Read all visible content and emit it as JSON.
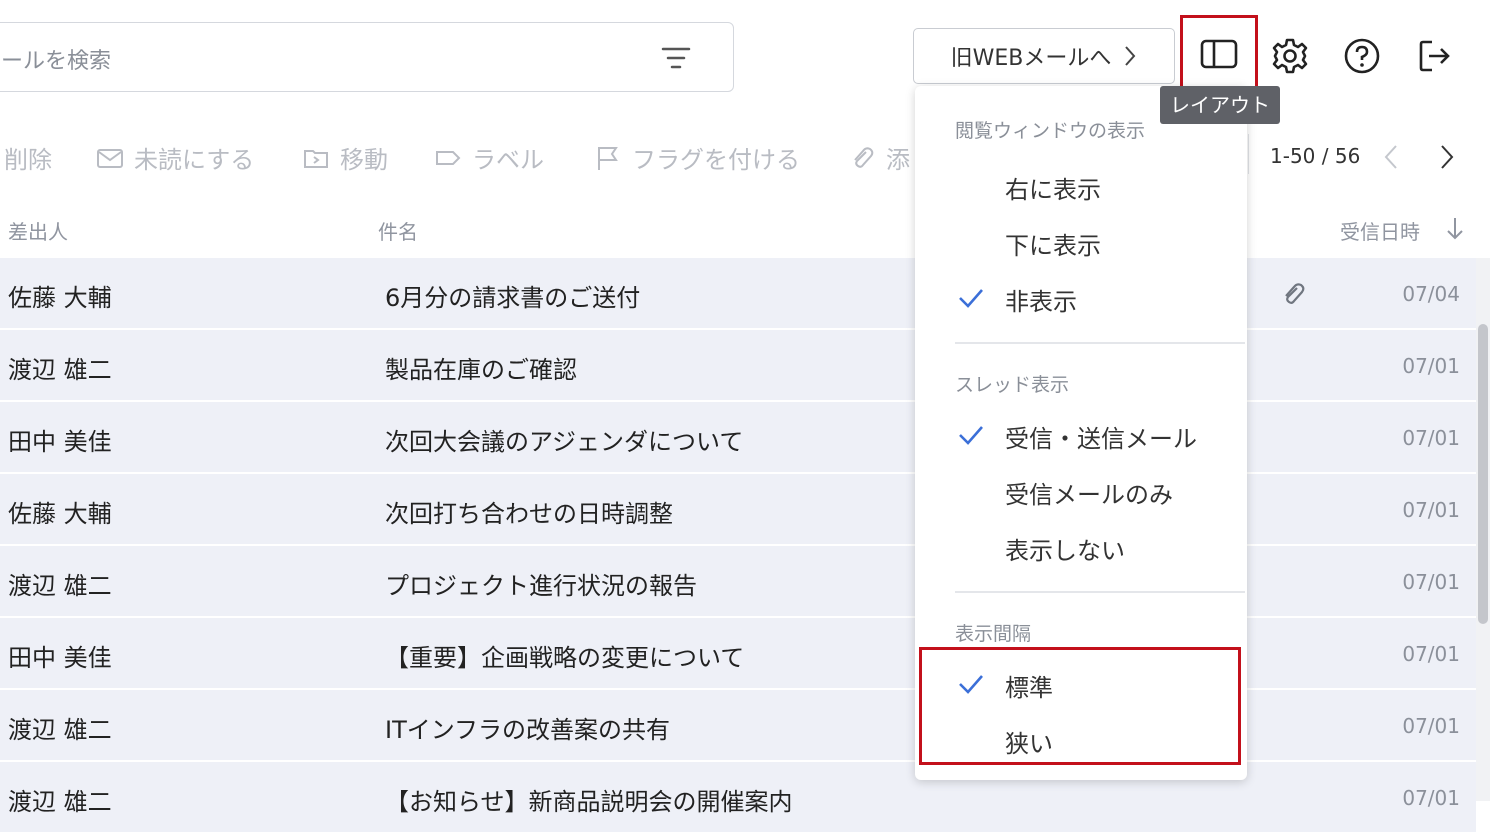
{
  "search": {
    "placeholder": "ールを検索",
    "filter_icon": "filter-icon"
  },
  "header": {
    "old_web_button": "旧WEBメールへ",
    "layout_tooltip": "レイアウト",
    "icons": [
      "layout-icon",
      "gear-icon",
      "help-icon",
      "logout-icon"
    ]
  },
  "toolbar": {
    "delete": "削除",
    "mark_unread": "未読にする",
    "move": "移動",
    "label": "ラベル",
    "flag": "フラグを付ける",
    "attach": "添",
    "pager": "1-50 / 56"
  },
  "columns": {
    "sender": "差出人",
    "subject": "件名",
    "received": "受信日時"
  },
  "rows": [
    {
      "sender": "佐藤 大輔",
      "subject": "6月分の請求書のご送付",
      "date": "07/04",
      "attachment": true
    },
    {
      "sender": "渡辺 雄二",
      "subject": "製品在庫のご確認",
      "date": "07/01",
      "attachment": false
    },
    {
      "sender": "田中 美佳",
      "subject": "次回大会議のアジェンダについて",
      "date": "07/01",
      "attachment": false
    },
    {
      "sender": "佐藤 大輔",
      "subject": "次回打ち合わせの日時調整",
      "date": "07/01",
      "attachment": false
    },
    {
      "sender": "渡辺 雄二",
      "subject": "プロジェクト進行状況の報告",
      "date": "07/01",
      "attachment": false
    },
    {
      "sender": "田中 美佳",
      "subject": "【重要】企画戦略の変更について",
      "date": "07/01",
      "attachment": false
    },
    {
      "sender": "渡辺 雄二",
      "subject": "ITインフラの改善案の共有",
      "date": "07/01",
      "attachment": false
    },
    {
      "sender": "渡辺 雄二",
      "subject": "【お知らせ】新商品説明会の開催案内",
      "date": "07/01",
      "attachment": false
    }
  ],
  "dropdown": {
    "reading_pane": {
      "title": "閲覧ウィンドウの表示",
      "items": [
        {
          "label": "右に表示",
          "checked": false
        },
        {
          "label": "下に表示",
          "checked": false
        },
        {
          "label": "非表示",
          "checked": true
        }
      ]
    },
    "thread": {
      "title": "スレッド表示",
      "items": [
        {
          "label": "受信・送信メール",
          "checked": true
        },
        {
          "label": "受信メールのみ",
          "checked": false
        },
        {
          "label": "表示しない",
          "checked": false
        }
      ]
    },
    "spacing": {
      "title": "表示間隔",
      "items": [
        {
          "label": "標準",
          "checked": true
        },
        {
          "label": "狭い",
          "checked": false
        }
      ]
    }
  },
  "colors": {
    "accent": "#3b6fd8",
    "highlight": "#c3101b",
    "row_bg": "#eef0f7"
  }
}
